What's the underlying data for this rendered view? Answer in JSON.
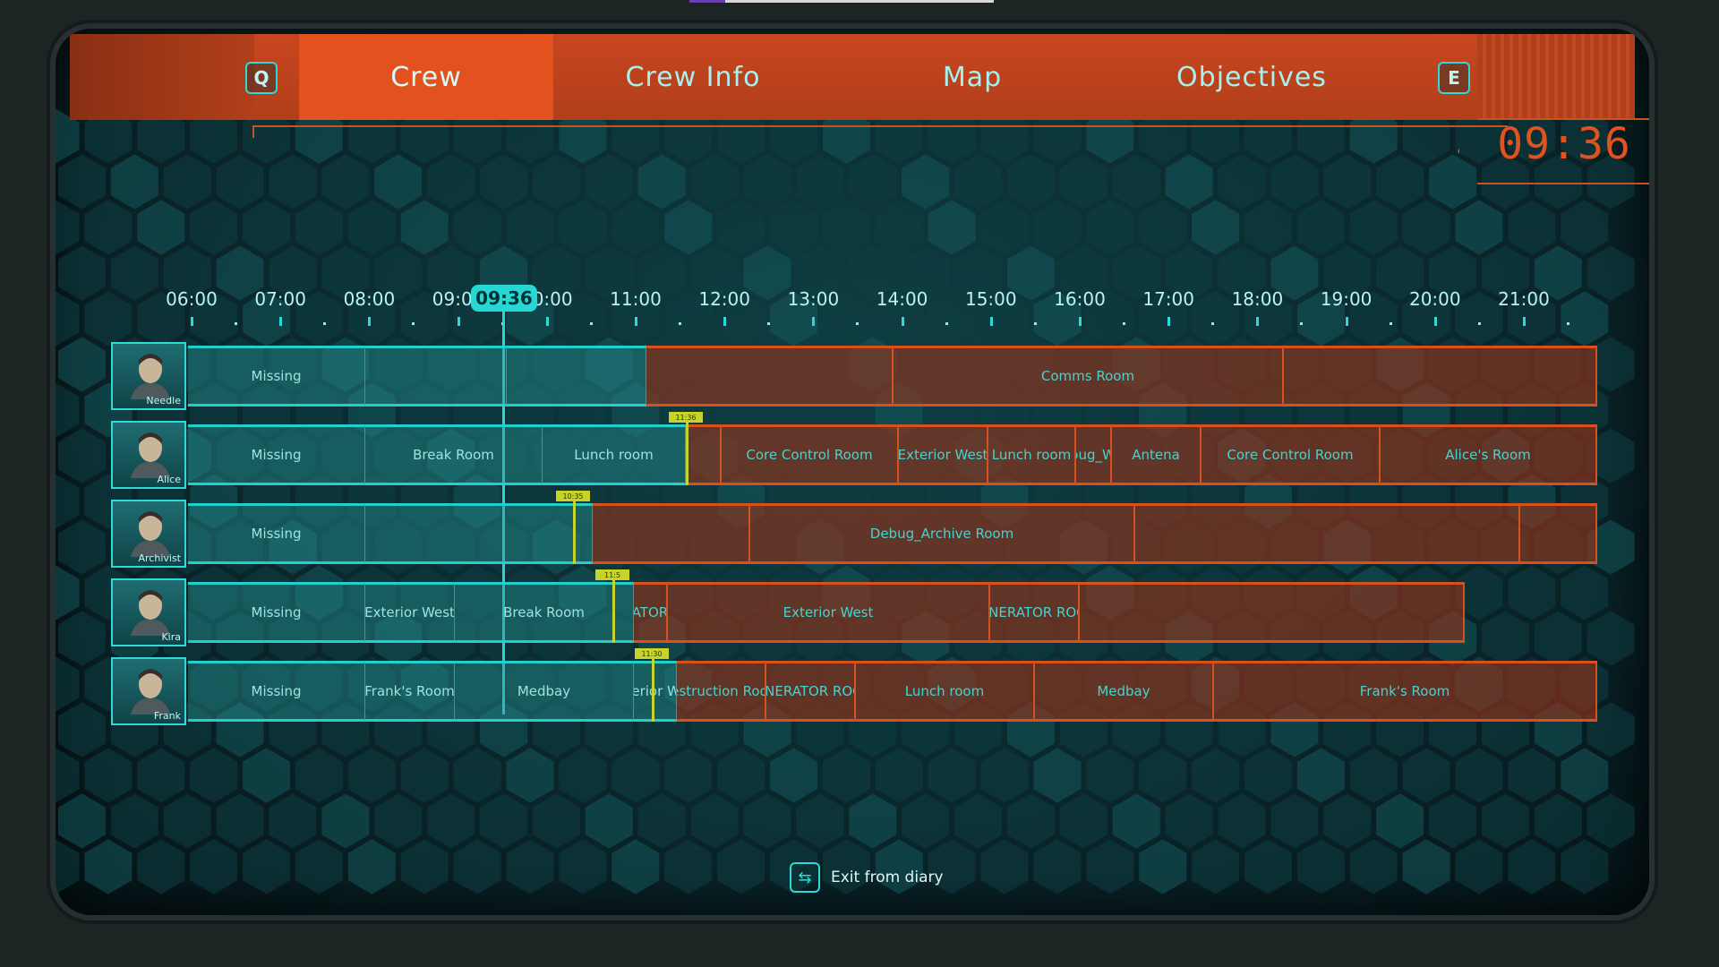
{
  "header": {
    "key_left": "Q",
    "key_right": "E",
    "tabs": [
      {
        "label": "Crew",
        "active": true
      },
      {
        "label": "Crew Info",
        "active": false
      },
      {
        "label": "Map",
        "active": false
      },
      {
        "label": "Objectives",
        "active": false
      }
    ],
    "clock": "09:36"
  },
  "timeline": {
    "hours": [
      "06:00",
      "07:00",
      "08:00",
      "09:00",
      "10:00",
      "11:00",
      "12:00",
      "13:00",
      "14:00",
      "15:00",
      "16:00",
      "17:00",
      "18:00",
      "19:00",
      "20:00",
      "21:00"
    ],
    "now": "09:36"
  },
  "crew": [
    {
      "name": "Needle",
      "segments": [
        {
          "label": "Missing",
          "kind": "past"
        },
        {
          "label": "",
          "kind": "past"
        },
        {
          "label": "",
          "kind": "past"
        },
        {
          "label": "",
          "kind": "future"
        },
        {
          "label": "Comms Room",
          "kind": "future"
        },
        {
          "label": "",
          "kind": "future"
        },
        {
          "label": "",
          "kind": "future"
        }
      ]
    },
    {
      "name": "Alice",
      "marker": "11:36",
      "segments": [
        {
          "label": "Missing",
          "kind": "past"
        },
        {
          "label": "Break Room",
          "kind": "past"
        },
        {
          "label": "Lunch room",
          "kind": "past"
        },
        {
          "label": "",
          "kind": "future"
        },
        {
          "label": "Core Control Room",
          "kind": "future"
        },
        {
          "label": "Exterior West",
          "kind": "future"
        },
        {
          "label": "Lunch room",
          "kind": "future"
        },
        {
          "label": "Debug_West",
          "kind": "future"
        },
        {
          "label": "Antena",
          "kind": "future"
        },
        {
          "label": "Core Control Room",
          "kind": "future"
        },
        {
          "label": "Alice's Room",
          "kind": "future"
        }
      ]
    },
    {
      "name": "Archivist",
      "marker": "10:35",
      "segments": [
        {
          "label": "Missing",
          "kind": "past"
        },
        {
          "label": "",
          "kind": "past"
        },
        {
          "label": "",
          "kind": "future"
        },
        {
          "label": "Debug_Archive Room",
          "kind": "future"
        },
        {
          "label": "",
          "kind": "future"
        },
        {
          "label": "",
          "kind": "future"
        }
      ]
    },
    {
      "name": "Kira",
      "marker": "11:5",
      "segments": [
        {
          "label": "Missing",
          "kind": "past"
        },
        {
          "label": "Exterior West",
          "kind": "past"
        },
        {
          "label": "Break Room",
          "kind": "past"
        },
        {
          "label": "GENERATOR ROOM",
          "kind": "future"
        },
        {
          "label": "Exterior West",
          "kind": "future"
        },
        {
          "label": "GENERATOR ROOM",
          "kind": "future"
        },
        {
          "label": "",
          "kind": "future"
        }
      ]
    },
    {
      "name": "Frank",
      "marker": "11:30",
      "segments": [
        {
          "label": "Missing",
          "kind": "past"
        },
        {
          "label": "Frank's Room",
          "kind": "past"
        },
        {
          "label": "Medbay",
          "kind": "past"
        },
        {
          "label": "Exterior West",
          "kind": "past"
        },
        {
          "label": "Destruction Room",
          "kind": "future"
        },
        {
          "label": "GENERATOR ROOM",
          "kind": "future"
        },
        {
          "label": "Lunch room",
          "kind": "future"
        },
        {
          "label": "Medbay",
          "kind": "future"
        },
        {
          "label": "Frank's Room",
          "kind": "future"
        }
      ]
    }
  ],
  "footer": {
    "exit_label": "Exit from diary"
  },
  "colors": {
    "accent_cyan": "#26d7d4",
    "accent_orange": "#e2521f",
    "marker_yellow": "#c7d22a"
  }
}
